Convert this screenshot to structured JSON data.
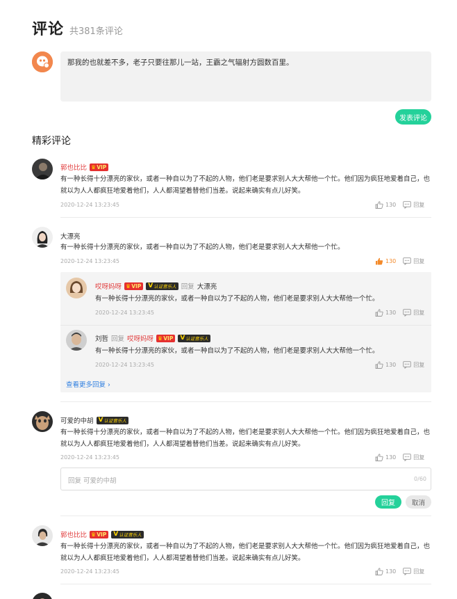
{
  "header": {
    "title": "评论",
    "count": "共381条评论"
  },
  "composer": {
    "text": "那我的也就差不多，老子只要往那儿一站，王霸之气辐射方圆数百里。",
    "post_label": "发表评论"
  },
  "section_title": "精彩评论",
  "badges": {
    "vip": "VIP",
    "cert": "认证音乐人",
    "cert_v": "V",
    "crown": "♛"
  },
  "colors": {
    "accent_green": "#24d19a",
    "vip_red": "#e53030",
    "link_blue": "#2f7fe0",
    "liked_orange": "#f38a2a"
  },
  "comments": [
    {
      "user": "郭也比比",
      "text": "有一种长得十分漂亮的家伙，或者一种自以为了不起的人物，他们老是要求别人大大帮他一个忙。他们因为疯狂地爱着自己，也就以为人人都疯狂地爱着他们，人人都渴望着替他们当差。说起来确实有点儿好笑。",
      "time": "2020-12-24 13:23:45",
      "likes": "130",
      "reply_label": "回复"
    },
    {
      "user": "大漂亮",
      "text": "有一种长得十分漂亮的家伙，或者一种自以为了不起的人物，他们老是要求别人大大帮他一个忙。",
      "time": "2020-12-24 13:23:45",
      "likes": "130",
      "reply_label": "回复",
      "replies": [
        {
          "user": "哎呀妈呀",
          "reply_word": "回复",
          "target": "大漂亮",
          "text": "有一种长得十分漂亮的家伙，或者一种自以为了不起的人物，他们老是要求别人大大帮他一个忙。",
          "time": "2020-12-24 13:23:45",
          "likes": "130",
          "reply_label": "回复"
        },
        {
          "user": "刘哲",
          "reply_word": "回复",
          "target": "哎呀妈呀",
          "text": "有一种长得十分漂亮的家伙，或者一种自以为了不起的人物，他们老是要求别人大大帮他一个忙。",
          "time": "2020-12-24 13:23:45",
          "likes": "130",
          "reply_label": "回复"
        }
      ],
      "more_replies": "查看更多回复 ›"
    },
    {
      "user": "可爱的中胡",
      "text": "有一种长得十分漂亮的家伙，或者一种自以为了不起的人物，他们老是要求别人大大帮他一个忙。他们因为疯狂地爱着自己，也就以为人人都疯狂地爱着他们，人人都渴望着替他们当差。说起来确实有点儿好笑。",
      "time": "2020-12-24 13:23:45",
      "likes": "130",
      "reply_label": "回复",
      "reply_input": {
        "placeholder": "回复 可爱的中胡",
        "counter": "0/60",
        "submit": "回复",
        "cancel": "取消"
      }
    },
    {
      "user": "郭也比比",
      "text": "有一种长得十分漂亮的家伙，或者一种自以为了不起的人物，他们老是要求别人大大帮他一个忙。他们因为疯狂地爱着自己，也就以为人人都疯狂地爱着他们，人人都渴望着替他们当差。说起来确实有点儿好笑。",
      "time": "2020-12-24 13:23:45",
      "likes": "130",
      "reply_label": "回复"
    }
  ]
}
